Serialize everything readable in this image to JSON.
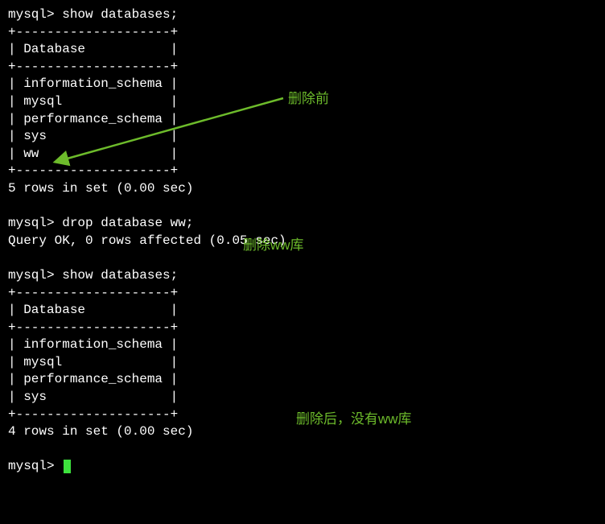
{
  "terminal": {
    "prompt": "mysql>",
    "cmd_show": "show databases;",
    "cmd_drop": "drop database ww;",
    "sep_plus": "+--------------------+",
    "header_row": "| Database           |",
    "rows_before": [
      "| information_schema |",
      "| mysql              |",
      "| performance_schema |",
      "| sys                |",
      "| ww                 |"
    ],
    "rows_after": [
      "| information_schema |",
      "| mysql              |",
      "| performance_schema |",
      "| sys                |"
    ],
    "result_before": "5 rows in set (0.00 sec)",
    "result_drop": "Query OK, 0 rows affected (0.05 sec)",
    "result_after": "4 rows in set (0.00 sec)"
  },
  "annotations": {
    "before": "删除前",
    "drop_comment": "删除ww库",
    "after": "删除后，没有ww库"
  }
}
